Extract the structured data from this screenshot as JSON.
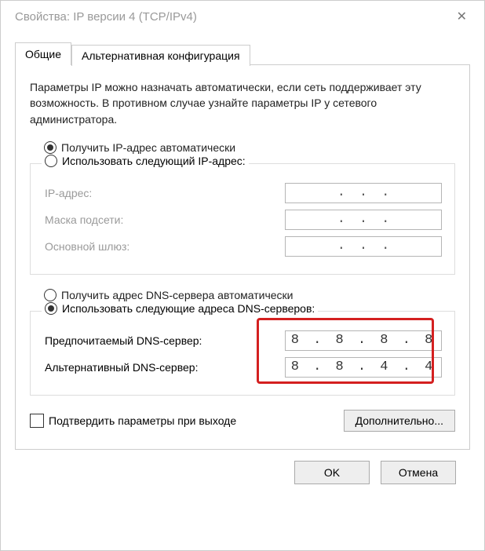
{
  "window": {
    "title": "Свойства: IP версии 4 (TCP/IPv4)"
  },
  "tabs": {
    "general": "Общие",
    "alternate": "Альтернативная конфигурация"
  },
  "intro": "Параметры IP можно назначать автоматически, если сеть поддерживает эту возможность. В противном случае узнайте параметры IP у сетевого администратора.",
  "ip_section": {
    "auto": "Получить IP-адрес автоматически",
    "manual": "Использовать следующий IP-адрес:",
    "ip_label": "IP-адрес:",
    "mask_label": "Маска подсети:",
    "gateway_label": "Основной шлюз:"
  },
  "dns_section": {
    "auto": "Получить адрес DNS-сервера автоматически",
    "manual": "Использовать следующие адреса DNS-серверов:",
    "preferred_label": "Предпочитаемый DNS-сервер:",
    "alternate_label": "Альтернативный DNS-сервер:",
    "preferred_value": "8 . 8 . 8 . 8",
    "alternate_value": "8 . 8 . 4 . 4"
  },
  "validate_label": "Подтвердить параметры при выходе",
  "advanced_btn": "Дополнительно...",
  "ok_btn": "OK",
  "cancel_btn": "Отмена"
}
